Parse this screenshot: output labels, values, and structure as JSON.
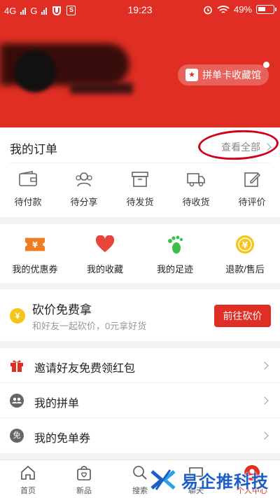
{
  "status_bar": {
    "carrier_left": "4G",
    "carrier_mid": "G",
    "box_glyph": "S",
    "time": "19:23",
    "battery": "49%"
  },
  "header": {
    "collect_button": "拼单卡收藏馆",
    "colors": {
      "brand": "#e02e24"
    }
  },
  "orders": {
    "title": "我的订单",
    "view_all": "查看全部",
    "items": [
      {
        "label": "待付款",
        "icon": "wallet-icon"
      },
      {
        "label": "待分享",
        "icon": "users-icon"
      },
      {
        "label": "待发货",
        "icon": "box-icon"
      },
      {
        "label": "待收货",
        "icon": "truck-icon"
      },
      {
        "label": "待评价",
        "icon": "edit-icon"
      }
    ]
  },
  "services": [
    {
      "label": "我的优惠券",
      "icon": "coupon-icon",
      "glyph": "¥"
    },
    {
      "label": "我的收藏",
      "icon": "heart-icon"
    },
    {
      "label": "我的足迹",
      "icon": "footprint-icon"
    },
    {
      "label": "退款/售后",
      "icon": "refund-icon",
      "glyph": "¥"
    }
  ],
  "bargain": {
    "title": "砍价免费拿",
    "subtitle": "和好友一起砍价，0元拿好货",
    "button": "前往砍价",
    "coin_glyph": "¥"
  },
  "list": [
    {
      "label": "邀请好友免费领红包",
      "icon": "gift-icon"
    },
    {
      "label": "我的拼单",
      "icon": "group-icon"
    },
    {
      "label": "我的免单券",
      "icon": "free-ticket-icon",
      "glyph": "免"
    }
  ],
  "bottom_nav": [
    {
      "label": "首页",
      "icon": "home-icon"
    },
    {
      "label": "新品",
      "icon": "bag-icon"
    },
    {
      "label": "搜索",
      "icon": "search-icon"
    },
    {
      "label": "聊天",
      "icon": "chat-icon"
    },
    {
      "label": "个人中心",
      "icon": "person-icon",
      "active": true
    }
  ],
  "watermark": {
    "text": "易企推科技",
    "colors": {
      "text": "#1d5fc9"
    }
  }
}
